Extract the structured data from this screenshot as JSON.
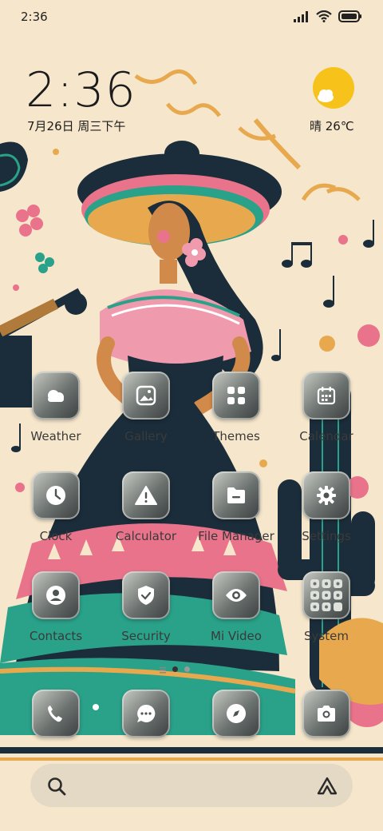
{
  "status_bar": {
    "time": "2:36",
    "signal_icon": "signal-icon",
    "wifi_icon": "wifi-icon",
    "battery_icon": "battery-icon"
  },
  "clock_widget": {
    "time": "2:36",
    "date": "7月26日 周三下午"
  },
  "weather_widget": {
    "icon": "partly-cloudy-icon",
    "text": "晴 26℃"
  },
  "apps": [
    {
      "label": "Weather",
      "icon": "weather-icon"
    },
    {
      "label": "Gallery",
      "icon": "gallery-icon"
    },
    {
      "label": "Themes",
      "icon": "themes-icon"
    },
    {
      "label": "Calendar",
      "icon": "calendar-icon"
    },
    {
      "label": "Clock",
      "icon": "clock-icon"
    },
    {
      "label": "Calculator",
      "icon": "calculator-icon"
    },
    {
      "label": "File Manager",
      "icon": "folder-icon"
    },
    {
      "label": "Settings",
      "icon": "gear-icon"
    },
    {
      "label": "Contacts",
      "icon": "contacts-icon"
    },
    {
      "label": "Security",
      "icon": "shield-icon"
    },
    {
      "label": "Mi Video",
      "icon": "eye-icon"
    },
    {
      "label": "System",
      "icon": "app-folder-icon"
    }
  ],
  "dock": [
    {
      "icon": "phone-icon"
    },
    {
      "icon": "messages-icon"
    },
    {
      "icon": "compass-icon"
    },
    {
      "icon": "camera-icon"
    }
  ],
  "search": {
    "search_icon": "search-icon",
    "assistant_icon": "assistant-icon"
  },
  "colors": {
    "background": "#f6e7cc",
    "icon_dark": "#3a3f3f",
    "sun": "#f7c21a"
  }
}
